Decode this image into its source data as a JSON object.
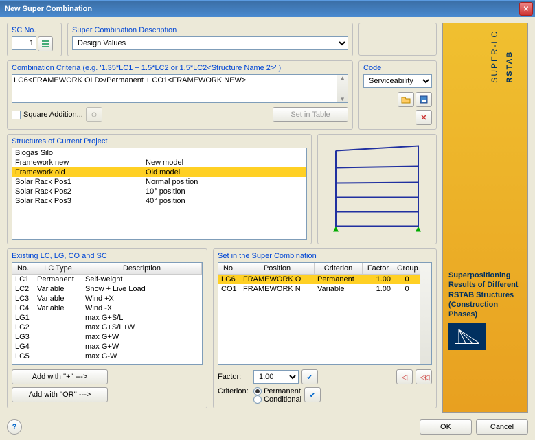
{
  "title": "New Super Combination",
  "sc": {
    "label": "SC No.",
    "value": "1"
  },
  "desc": {
    "label": "Super Combination Description",
    "value": "Design Values"
  },
  "criteria": {
    "label": "Combination Criteria (e.g. '1.35*LC1 + 1.5*LC2 or 1.5*LC2<Structure Name 2>' )",
    "text": "LG6<FRAMEWORK OLD>/Permanent + CO1<FRAMEWORK NEW>"
  },
  "square": "Square Addition...",
  "set_in_table": "Set in Table",
  "code": {
    "label": "Code",
    "value": "Serviceability"
  },
  "structures": {
    "label": "Structures of Current Project",
    "rows": [
      {
        "name": "Biogas Silo",
        "pos": ""
      },
      {
        "name": "Framework new",
        "pos": "New model"
      },
      {
        "name": "Framework old",
        "pos": "Old model",
        "sel": true
      },
      {
        "name": "Solar Rack Pos1",
        "pos": "Normal position"
      },
      {
        "name": "Solar Rack Pos2",
        "pos": "10° position"
      },
      {
        "name": "Solar Rack Pos3",
        "pos": "40° position"
      }
    ]
  },
  "lc": {
    "label": "Existing LC, LG, CO and SC",
    "headers": [
      "No.",
      "LC Type",
      "Description"
    ],
    "rows": [
      {
        "no": "LC1",
        "type": "Permanent",
        "desc": "Self-weight"
      },
      {
        "no": "LC2",
        "type": "Variable",
        "desc": "Snow + Live Load"
      },
      {
        "no": "LC3",
        "type": "Variable",
        "desc": "Wind +X"
      },
      {
        "no": "LC4",
        "type": "Variable",
        "desc": "Wind -X"
      },
      {
        "no": "LG1",
        "type": "",
        "desc": "max G+S/L"
      },
      {
        "no": "LG2",
        "type": "",
        "desc": "max G+S/L+W"
      },
      {
        "no": "LG3",
        "type": "",
        "desc": "max G+W"
      },
      {
        "no": "LG4",
        "type": "",
        "desc": "max G+W"
      },
      {
        "no": "LG5",
        "type": "",
        "desc": "max G-W"
      }
    ],
    "add_plus": "Add with  ''+'' --->",
    "add_or": "Add with  ''OR'' --->"
  },
  "setcombo": {
    "label": "Set in the Super Combination",
    "headers": [
      "No.",
      "Position",
      "Criterion",
      "Factor",
      "Group"
    ],
    "rows": [
      {
        "no": "LG6",
        "pos": "FRAMEWORK O",
        "crit": "Permanent",
        "factor": "1.00",
        "group": "0",
        "sel": true
      },
      {
        "no": "CO1",
        "pos": "FRAMEWORK N",
        "crit": "Variable",
        "factor": "1.00",
        "group": "0"
      }
    ],
    "factor_label": "Factor:",
    "factor_value": "1.00",
    "criterion_label": "Criterion:",
    "perm": "Permanent",
    "cond": "Conditional"
  },
  "banner": {
    "product": "RSTAB",
    "sub": "SUPER-LC",
    "text": "Superpositioning Results of Different RSTAB Structures (Construction Phases)"
  },
  "ok": "OK",
  "cancel": "Cancel"
}
